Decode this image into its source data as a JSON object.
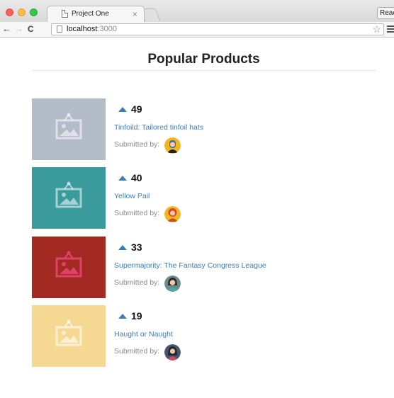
{
  "browser": {
    "tab_title": "Project One",
    "tab_close": "×",
    "extension_label": "React",
    "url_host": "localhost",
    "url_port": ":3000",
    "back_glyph": "←",
    "forward_glyph": "→",
    "reload_glyph": "C",
    "star_glyph": "☆"
  },
  "page": {
    "title": "Popular Products"
  },
  "products": [
    {
      "votes": "49",
      "title": "Tinfoild: Tailored tinfoil hats",
      "submitted_label": "Submitted by:",
      "thumb_color": "#b3bbc9",
      "avatar": "avatar-1"
    },
    {
      "votes": "40",
      "title": "Yellow Pail",
      "submitted_label": "Submitted by:",
      "thumb_color": "#3a9a9c",
      "avatar": "avatar-2"
    },
    {
      "votes": "33",
      "title": "Supermajority: The Fantasy Congress League",
      "submitted_label": "Submitted by:",
      "thumb_color": "#a22a23",
      "avatar": "avatar-3"
    },
    {
      "votes": "19",
      "title": "Haught or Naught",
      "submitted_label": "Submitted by:",
      "thumb_color": "#f5d993",
      "avatar": "avatar-4"
    }
  ],
  "colors": {
    "link": "#3e7cb8",
    "upvote": "#3e7cb8"
  }
}
